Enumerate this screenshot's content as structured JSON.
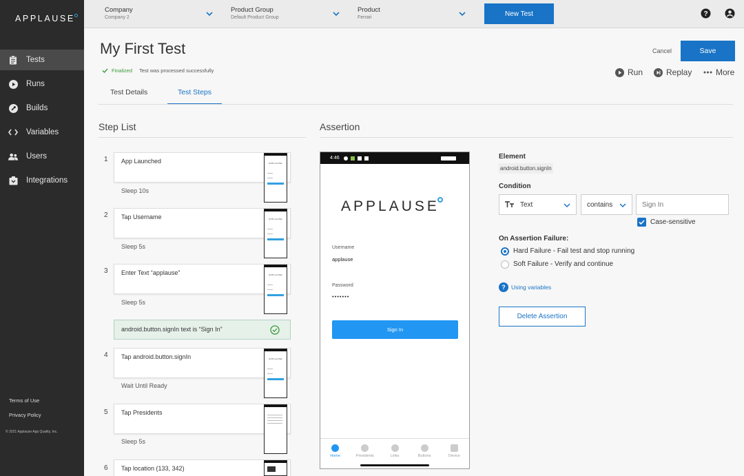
{
  "sidebar": {
    "logo": "APPLAUSE",
    "items": [
      {
        "label": "Tests",
        "icon": "clipboard-icon"
      },
      {
        "label": "Runs",
        "icon": "play-circle-icon"
      },
      {
        "label": "Builds",
        "icon": "wrench-icon"
      },
      {
        "label": "Variables",
        "icon": "code-icon"
      },
      {
        "label": "Users",
        "icon": "users-icon"
      },
      {
        "label": "Integrations",
        "icon": "plug-icon"
      }
    ],
    "terms": "Terms of Use",
    "privacy": "Privacy Policy",
    "copyright": "© 2021 Applause App Quality, Inc."
  },
  "topbar": {
    "company": {
      "label": "Company",
      "value": "Company 2"
    },
    "product_group": {
      "label": "Product Group",
      "value": "Default Product Group"
    },
    "product": {
      "label": "Product",
      "value": "Ferrari"
    },
    "new_test": "New Test"
  },
  "header": {
    "title": "My First Test",
    "status": "Finalized",
    "status_message": "Test was processed successfully",
    "cancel": "Cancel",
    "save": "Save",
    "run": "Run",
    "replay": "Replay",
    "more": "More",
    "tabs": [
      "Test Details",
      "Test Steps"
    ]
  },
  "step_list": {
    "heading": "Step List",
    "steps": [
      {
        "num": "1",
        "action": "App Launched",
        "wait": "Sleep 10s"
      },
      {
        "num": "2",
        "action": "Tap Username",
        "wait": "Sleep 5s"
      },
      {
        "num": "3",
        "action": "Enter Text “applause”",
        "wait": "Sleep 5s"
      },
      {
        "num": "4",
        "action": "Tap android.button.signIn",
        "wait": "Wait Until Ready"
      },
      {
        "num": "5",
        "action": "Tap Presidents",
        "wait": "Sleep 5s"
      },
      {
        "num": "6",
        "action": "Tap location (133, 342)",
        "wait": ""
      }
    ],
    "assertion_step": "android.button.signIn text is “Sign In”"
  },
  "assertion": {
    "heading": "Assertion",
    "phone": {
      "time": "4:46",
      "logo": "APPLAUSE",
      "username_label": "Username",
      "username_value": "applause",
      "password_label": "Password",
      "password_value": "•••••••",
      "sign_in": "Sign In",
      "nav": [
        "Home",
        "Presidents",
        "Links",
        "Buttons",
        "Device"
      ]
    },
    "element_label": "Element",
    "element_value": "android.button.signIn",
    "condition_label": "Condition",
    "condition_type": "Text",
    "condition_op": "contains",
    "condition_placeholder": "Sign In",
    "case_sensitive": "Case-sensitive",
    "failure_label": "On Assertion Failure:",
    "hard_failure": "Hard Failure - Fail test and stop running",
    "soft_failure": "Soft Failure - Verify and continue",
    "using_variables": "Using variables",
    "delete": "Delete Assertion"
  },
  "colors": {
    "accent": "#1973c6",
    "sidebar": "#2b2b2b",
    "success": "#3b9b3b",
    "assertion_bg": "#e6f1ea"
  }
}
